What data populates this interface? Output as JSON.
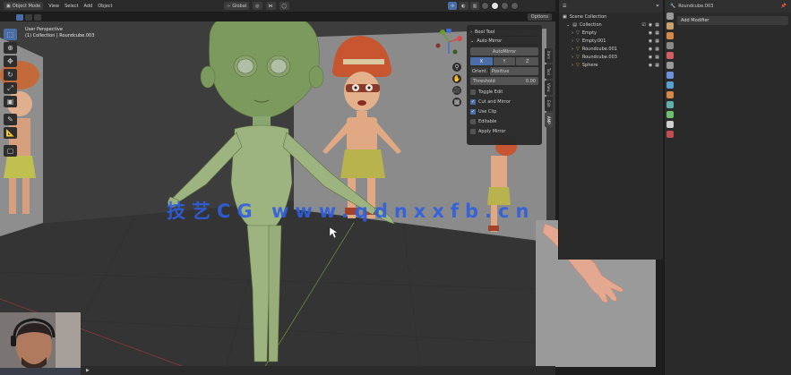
{
  "header": {
    "mode": "Object Mode",
    "menus": [
      "View",
      "Select",
      "Add",
      "Object"
    ],
    "transform_orientation": "Global",
    "options_label": "Options"
  },
  "viewport": {
    "view_name": "User Perspective",
    "collection_path": "(1) Collection | Roundcube.003"
  },
  "toolbar": {
    "tools": [
      {
        "name": "select-box-tool",
        "glyph": "⬚",
        "active": true
      },
      {
        "name": "cursor-tool",
        "glyph": "⊕"
      },
      {
        "name": "move-tool",
        "glyph": "✥"
      },
      {
        "name": "rotate-tool",
        "glyph": "↻"
      },
      {
        "name": "scale-tool",
        "glyph": "⤢"
      },
      {
        "name": "transform-tool",
        "glyph": "▣"
      },
      {
        "name": "annotate-tool",
        "glyph": "✎"
      },
      {
        "name": "measure-tool",
        "glyph": "📐"
      },
      {
        "name": "add-cube-tool",
        "glyph": "▢"
      }
    ]
  },
  "npanel": {
    "sections": {
      "booltool": "Bool Tool",
      "automirror": "Auto Mirror"
    },
    "automirror_button": "AutoMirror",
    "axes": [
      {
        "label": "X",
        "on": true
      },
      {
        "label": "Y",
        "on": false
      },
      {
        "label": "Z",
        "on": false
      }
    ],
    "orientation_label": "Orient.",
    "orientation_value": "Positive",
    "threshold_label": "Threshold",
    "threshold_value": "0.00",
    "checkboxes": [
      {
        "label": "Toggle Edit",
        "on": false
      },
      {
        "label": "Cut and Mirror",
        "on": true
      },
      {
        "label": "Use Clip",
        "on": true
      },
      {
        "label": "Editable",
        "on": false
      },
      {
        "label": "Apply Mirror",
        "on": false
      }
    ],
    "tabs": [
      "Item",
      "Tool",
      "View",
      "Edit",
      "AMP"
    ]
  },
  "outliner": {
    "title": "Scene Collection",
    "collection": "Collection",
    "items": [
      {
        "label": "Empty",
        "color": "#aaaaaa"
      },
      {
        "label": "Empty.001",
        "color": "#aaaaaa"
      },
      {
        "label": "Roundcube.001",
        "color": "#e8a33c"
      },
      {
        "label": "Roundcube.003",
        "color": "#e8a33c"
      },
      {
        "label": "Sphere",
        "color": "#e8a33c"
      }
    ]
  },
  "properties": {
    "object_name": "Roundcube.003",
    "add_modifier": "Add Modifier"
  },
  "watermark": "技艺CG www.qdnxxfb.cn",
  "colors": {
    "accent": "#4b6ea8",
    "character_green": "#7d9a5e",
    "watermark": "#2f5fe0"
  }
}
